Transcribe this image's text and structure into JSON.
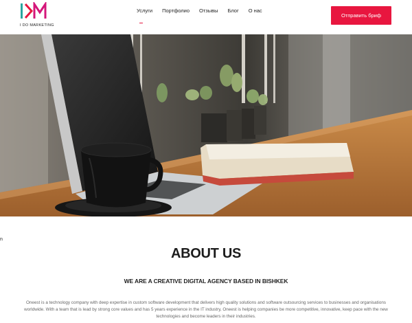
{
  "brand": {
    "logo_text": "I DO MARKETING",
    "accent": "#e8163f",
    "logo_teal": "#2aa6a0",
    "logo_magenta": "#d4167a"
  },
  "nav": {
    "items": [
      {
        "label": "Услуги"
      },
      {
        "label": "Портфолио"
      },
      {
        "label": "Отзывы"
      },
      {
        "label": "Блог"
      },
      {
        "label": "О нас"
      }
    ]
  },
  "header": {
    "cta_label": "Отправить бриф"
  },
  "about": {
    "stray": "n",
    "title": "ABOUT US",
    "subtitle": "WE ARE A CREATIVE DIGITAL AGENCY BASED IN BISHKEK",
    "body": "Oneest is a technology company with deep expertise in custom software development that delivers high quality solutions and software outsourcing services to businesses and organisations worldwide. With a team that is lead by strong core values and has 5 years experience in the IT industry, Oneest is helping companies be more competitive, innovative, keep pace with the new technologies and become leaders in their industries."
  }
}
